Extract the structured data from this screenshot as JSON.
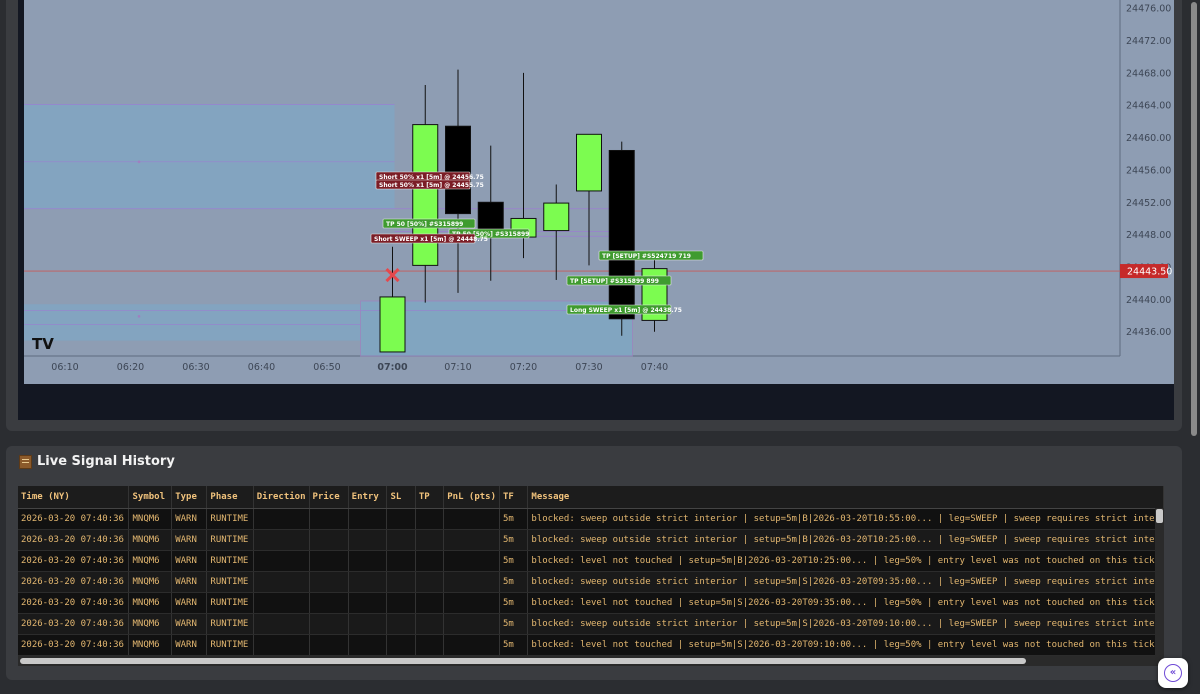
{
  "colors": {
    "plot_bg": "#8e9db3",
    "bull": "#7cfc50",
    "bear": "#000000",
    "zone": "#7fa7c4",
    "price_tag": "#c62a2a",
    "label_green": "#3f9b2f",
    "label_red": "#7b1d26",
    "header_text": "#f0c27c",
    "cell_text": "#e3b770"
  },
  "chart_data": {
    "type": "candlestick",
    "title": "",
    "symbol": "MNQM6",
    "timeframe": "5m",
    "x_ticks": [
      "06:10",
      "06:20",
      "06:30",
      "06:40",
      "06:50",
      "07:00",
      "07:10",
      "07:20",
      "07:30",
      "07:40"
    ],
    "x_tick_bold": "07:00",
    "y_ticks": [
      "24476.00",
      "24472.00",
      "24468.00",
      "24464.00",
      "24460.00",
      "24456.00",
      "24452.00",
      "24448.00",
      "24444.00",
      "24440.00",
      "24436.00"
    ],
    "ylim": [
      24433,
      24477
    ],
    "current_price": "24443.50",
    "current_price_value": 24443.5,
    "grid": false,
    "candles": [
      {
        "time": "07:00",
        "open": 24433.5,
        "high": 24446.5,
        "low": 24433.5,
        "close": 24440.3
      },
      {
        "time": "07:05",
        "open": 24444.2,
        "high": 24466.5,
        "low": 24439.6,
        "close": 24461.6
      },
      {
        "time": "07:10",
        "open": 24461.4,
        "high": 24468.4,
        "low": 24440.8,
        "close": 24450.6
      },
      {
        "time": "07:15",
        "open": 24452.0,
        "high": 24459.0,
        "low": 24442.3,
        "close": 24448.4
      },
      {
        "time": "07:20",
        "open": 24447.7,
        "high": 24468.0,
        "low": 24445.1,
        "close": 24450.0
      },
      {
        "time": "07:25",
        "open": 24448.5,
        "high": 24454.2,
        "low": 24442.4,
        "close": 24451.9
      },
      {
        "time": "07:30",
        "open": 24453.4,
        "high": 24460.0,
        "low": 24444.2,
        "close": 24460.4
      },
      {
        "time": "07:35",
        "open": 24458.4,
        "high": 24459.5,
        "low": 24435.5,
        "close": 24437.6
      },
      {
        "time": "07:40",
        "open": 24437.4,
        "high": 24445.8,
        "low": 24436.0,
        "close": 24443.8
      }
    ],
    "annotations": [
      {
        "text": "Short 50% x1 [5m] @ 24456.75",
        "style": "red"
      },
      {
        "text": "Short 50% x1 [5m] @ 24455.75",
        "style": "red"
      },
      {
        "text": "TP 50 [50%] #S315899",
        "style": "green"
      },
      {
        "text": "TP 50 [50%] #S315899",
        "style": "green"
      },
      {
        "text": "Short SWEEP x1 [5m] @ 24448.75",
        "style": "red"
      },
      {
        "text": "TP [SETUP] #S524719 719",
        "style": "green"
      },
      {
        "text": "TP [SETUP] #S315899 899",
        "style": "green"
      },
      {
        "text": "Long SWEEP x1 [5m] @ 24438.75",
        "style": "green"
      }
    ],
    "watermark": "TV"
  },
  "history": {
    "title": "Live Signal History",
    "columns": [
      "Time (NY)",
      "Symbol",
      "Type",
      "Phase",
      "Direction",
      "Price",
      "Entry",
      "SL",
      "TP",
      "PnL (pts)",
      "TF",
      "Message"
    ],
    "rows": [
      [
        "2026-03-20 07:40:36",
        "MNQM6",
        "WARN",
        "RUNTIME",
        "",
        "",
        "",
        "",
        "",
        "",
        "5m",
        "blocked: sweep outside strict interior | setup=5m|B|2026-03-20T10:55:00... | leg=SWEEP | sweep requires strict inter"
      ],
      [
        "2026-03-20 07:40:36",
        "MNQM6",
        "WARN",
        "RUNTIME",
        "",
        "",
        "",
        "",
        "",
        "",
        "5m",
        "blocked: sweep outside strict interior | setup=5m|B|2026-03-20T10:25:00... | leg=SWEEP | sweep requires strict inter"
      ],
      [
        "2026-03-20 07:40:36",
        "MNQM6",
        "WARN",
        "RUNTIME",
        "",
        "",
        "",
        "",
        "",
        "",
        "5m",
        "blocked: level not touched | setup=5m|B|2026-03-20T10:25:00... | leg=50% | entry level was not touched on this tick"
      ],
      [
        "2026-03-20 07:40:36",
        "MNQM6",
        "WARN",
        "RUNTIME",
        "",
        "",
        "",
        "",
        "",
        "",
        "5m",
        "blocked: sweep outside strict interior | setup=5m|S|2026-03-20T09:35:00... | leg=SWEEP | sweep requires strict inter"
      ],
      [
        "2026-03-20 07:40:36",
        "MNQM6",
        "WARN",
        "RUNTIME",
        "",
        "",
        "",
        "",
        "",
        "",
        "5m",
        "blocked: level not touched | setup=5m|S|2026-03-20T09:35:00... | leg=50% | entry level was not touched on this tick"
      ],
      [
        "2026-03-20 07:40:36",
        "MNQM6",
        "WARN",
        "RUNTIME",
        "",
        "",
        "",
        "",
        "",
        "",
        "5m",
        "blocked: sweep outside strict interior | setup=5m|S|2026-03-20T09:10:00... | leg=SWEEP | sweep requires strict inter"
      ],
      [
        "2026-03-20 07:40:36",
        "MNQM6",
        "WARN",
        "RUNTIME",
        "",
        "",
        "",
        "",
        "",
        "",
        "5m",
        "blocked: level not touched | setup=5m|S|2026-03-20T09:10:00... | leg=50% | entry level was not touched on this tick"
      ]
    ]
  },
  "icons": {
    "history": "ledger-icon",
    "collapse": "double-chevron-left-icon",
    "trade_marker": "x-icon"
  }
}
